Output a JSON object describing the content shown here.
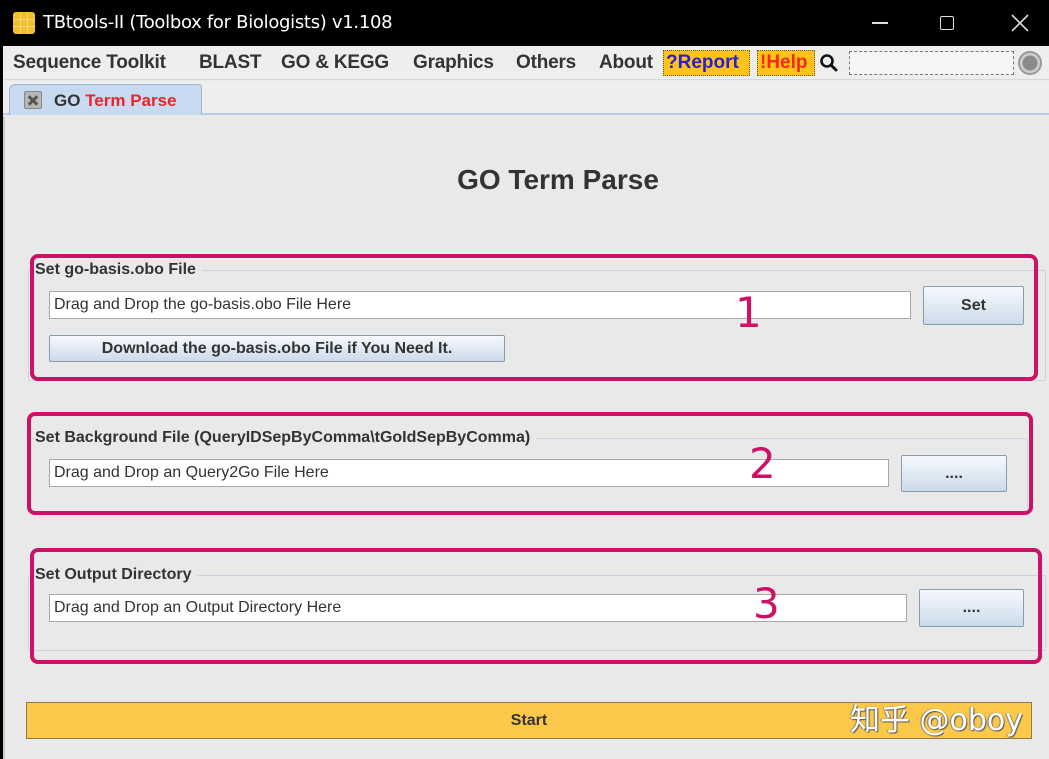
{
  "window": {
    "title": "TBtools-II (Toolbox for Biologists) v1.108",
    "controls": {
      "minimize": "—",
      "close": "✕"
    }
  },
  "menubar": {
    "items": [
      "Sequence Toolkit",
      "BLAST",
      "GO & KEGG",
      "Graphics",
      "Others",
      "About"
    ],
    "report_label": "?Report",
    "help_label": "!Help",
    "search_value": ""
  },
  "tab": {
    "label_part1": "GO",
    "label_part2": "Term Parse"
  },
  "main": {
    "title": "GO Term Parse",
    "sections": [
      {
        "legend": "Set go-basis.obo File",
        "input_value": "Drag and Drop the go-basis.obo File Here",
        "button_label": "Set",
        "download_label": "Download the go-basis.obo File if You Need It.",
        "annotation": "1"
      },
      {
        "legend": "Set Background File (QueryIDSepByComma\\tGoIdSepByComma)",
        "input_value": "Drag and Drop an Query2Go File Here",
        "button_label": "....",
        "annotation": "2"
      },
      {
        "legend": "Set Output Directory",
        "input_value": "Drag and Drop an Output Directory Here",
        "button_label": "....",
        "annotation": "3"
      }
    ],
    "start_label": "Start"
  },
  "watermark": "知乎 @oboy",
  "colors": {
    "accent_yellow": "#fcc84a",
    "highlight": "#cc1166",
    "report_text": "#2a1fd0",
    "help_text": "#f42a1a",
    "tab_red": "#e6262a"
  }
}
